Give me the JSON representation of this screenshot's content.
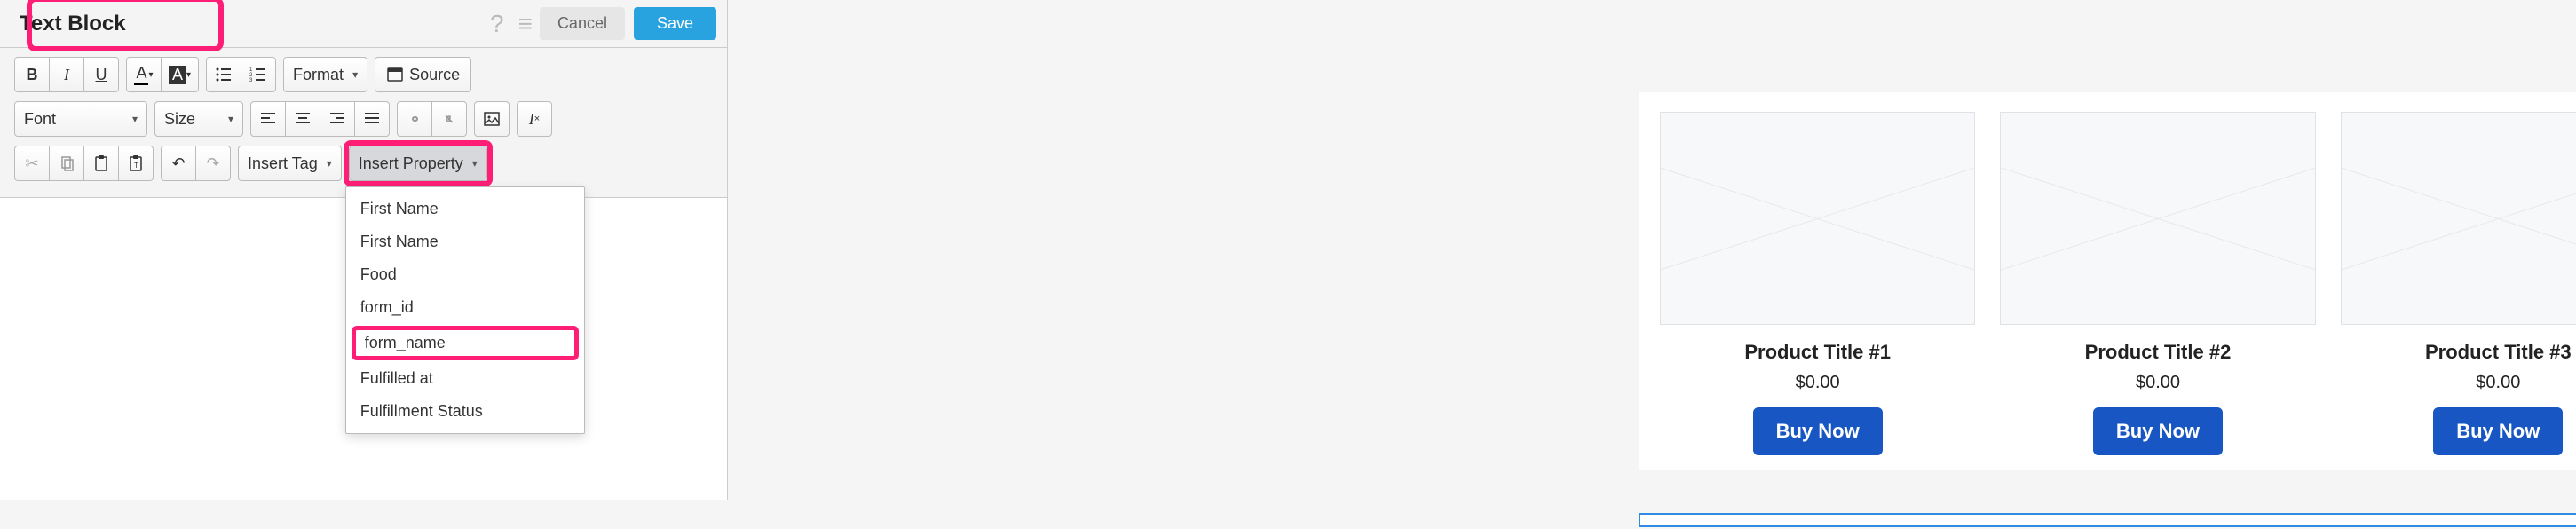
{
  "header": {
    "title": "Text Block",
    "cancel_label": "Cancel",
    "save_label": "Save"
  },
  "toolbar": {
    "format_label": "Format",
    "source_label": "Source",
    "font_label": "Font",
    "size_label": "Size",
    "insert_tag_label": "Insert Tag",
    "insert_property_label": "Insert Property"
  },
  "insert_property_menu": [
    "First Name",
    "First Name",
    "Food",
    "form_id",
    "form_name",
    "Fulfilled at",
    "Fulfillment Status"
  ],
  "insert_property_highlight_index": 4,
  "products": [
    {
      "title": "Product Title #1",
      "price": "$0.00",
      "cta": "Buy Now"
    },
    {
      "title": "Product Title #2",
      "price": "$0.00",
      "cta": "Buy Now"
    },
    {
      "title": "Product Title #3",
      "price": "$0.00",
      "cta": "Buy Now"
    }
  ],
  "colors": {
    "highlight": "#ff1e76",
    "primary_button": "#1857c3",
    "save_button": "#29a3e0",
    "selection": "#2f8de4"
  }
}
